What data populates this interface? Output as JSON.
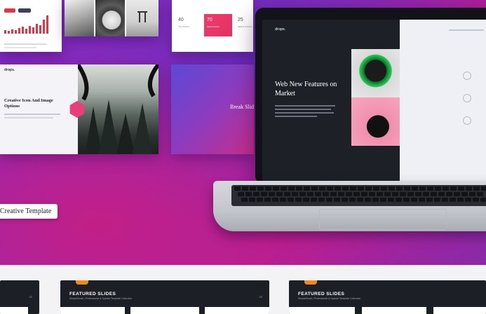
{
  "hero": {
    "colors": {
      "purple": "#7a2cc6",
      "magenta": "#c21f86"
    },
    "tag_label": "Creative Template"
  },
  "slide_stats": {
    "items": [
      {
        "value": "40",
        "label": "The Product"
      },
      {
        "value": "70",
        "label": "Opportunities"
      },
      {
        "value": "25",
        "label": "Market Position"
      }
    ]
  },
  "slide_creative": {
    "brand": "drops.",
    "title": "Creative Icon And Image Options"
  },
  "slide_break": {
    "title": "Break Slide"
  },
  "laptop_screen": {
    "brand": "drops.",
    "title": "Web New Features on Market"
  },
  "bottom_cards": [
    {
      "title": "",
      "number": "02"
    },
    {
      "title": "FEATURED SLIDES",
      "subtitle": "SimpleSmart | Professional & Special Template Collection",
      "number": "03"
    },
    {
      "title": "FEATURED SLIDES",
      "subtitle": "SimpleSmart | Professional & Special Template Collection",
      "number": ""
    }
  ]
}
